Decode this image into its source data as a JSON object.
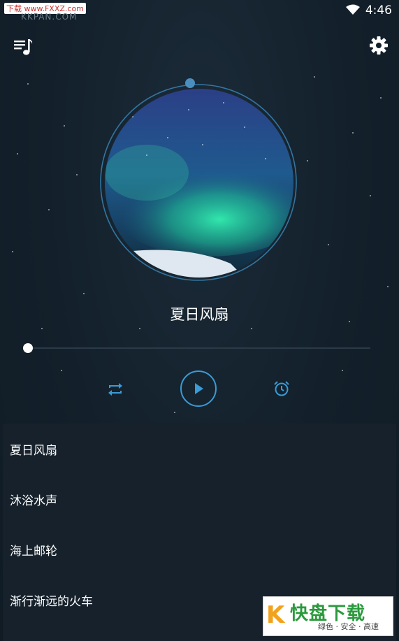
{
  "status_bar": {
    "time": "4:46",
    "watermark_tag": "下载 www.FXXZ.com",
    "watermark_sub": "KKPAN.COM"
  },
  "toolbar": {
    "playlist_icon": "playlist-music-icon",
    "settings_icon": "gear-icon"
  },
  "player": {
    "title": "夏日风扇",
    "progress": 0.0,
    "repeat_icon": "repeat-icon",
    "play_icon": "play-icon",
    "timer_icon": "alarm-clock-icon"
  },
  "playlist": {
    "items": [
      {
        "label": "夏日风扇"
      },
      {
        "label": "沐浴水声"
      },
      {
        "label": "海上邮轮"
      },
      {
        "label": "渐行渐远的火车"
      }
    ]
  },
  "watermark": {
    "k": "K",
    "main": "快盘下载",
    "sub": "绿色 · 安全 · 高速"
  },
  "colors": {
    "accent": "#3a9bd5",
    "background": "#13202b",
    "list_background": "#16212b"
  }
}
